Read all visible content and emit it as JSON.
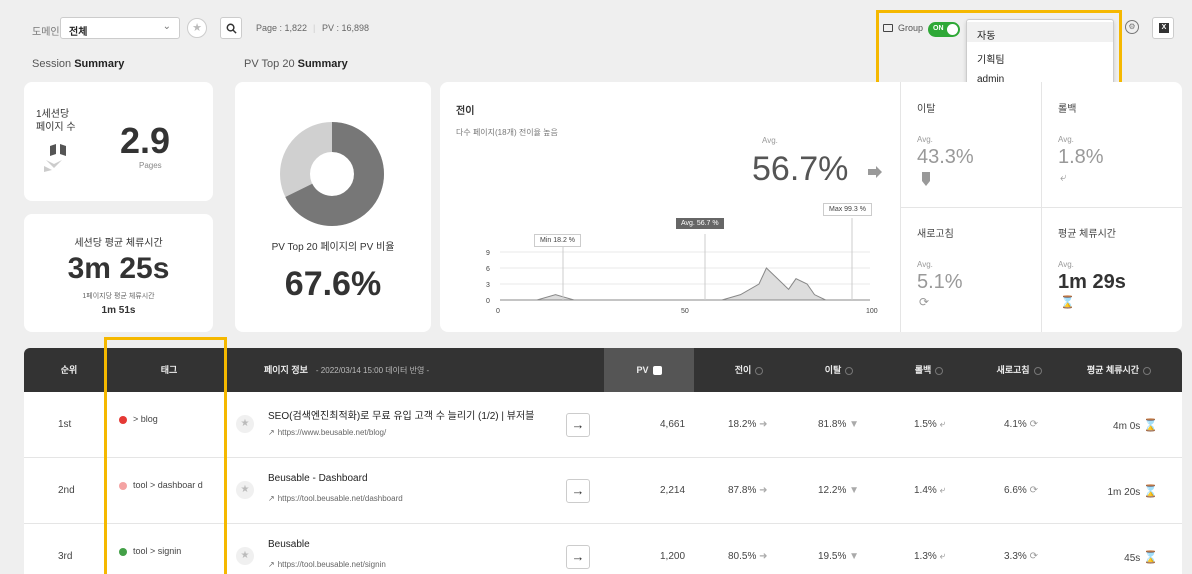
{
  "topbar": {
    "domain_label": "도메인",
    "domain_value": "전체",
    "page_count": "Page : 1,822",
    "pv_count": "PV : 16,898",
    "group_label": "Group",
    "toggle_label": "ON",
    "dropdown_options": [
      "자동",
      "기획팀",
      "admin"
    ],
    "excel_label": "X"
  },
  "sections": {
    "session_summary": "Session",
    "session_summary_bold": "Summary",
    "pv_summary": "PV Top 20",
    "pv_summary_bold": "Summary"
  },
  "session": {
    "pages_per_session_label_1": "1세션당",
    "pages_per_session_label_2": "페이지 수",
    "pages_per_session_value": "2.9",
    "pages_unit": "Pages",
    "avg_dwell_label": "세션당 평균 체류시간",
    "avg_dwell_value": "3m 25s",
    "page_dwell_label": "1페이지당 평균 체류시간",
    "page_dwell_value": "1m 51s"
  },
  "pv_top": {
    "ratio_label": "PV Top 20 페이지의 PV 비율",
    "ratio_value": "67.6%",
    "donut_fraction": 0.676
  },
  "transition": {
    "title": "전이",
    "subtitle": "다수 페이지(18개) 전이율 높음",
    "avg_label": "Avg.",
    "avg_value": "56.7%",
    "callouts": [
      "Min 18.2 %",
      "Avg. 56.7 %",
      "Max 99.3 %"
    ]
  },
  "chart_data": {
    "type": "area",
    "x_ticks": [
      "0",
      "50",
      "100"
    ],
    "y_ticks": [
      "9",
      "6",
      "3",
      "0"
    ],
    "xlim": [
      0,
      100
    ],
    "ylim": [
      0,
      9
    ],
    "x": [
      0,
      10,
      15,
      20,
      50,
      60,
      65,
      70,
      72,
      75,
      78,
      80,
      83,
      85,
      88,
      90,
      100
    ],
    "y": [
      0,
      0,
      1,
      0,
      0,
      0,
      1,
      3,
      6,
      4,
      2,
      4,
      3,
      1,
      0,
      0,
      0
    ]
  },
  "stats": [
    {
      "title": "이탈",
      "avg": "Avg.",
      "value": "43.3%",
      "icon": "exit-icon"
    },
    {
      "title": "롤백",
      "avg": "Avg.",
      "value": "1.8%",
      "icon": "rollback-icon"
    },
    {
      "title": "새로고침",
      "avg": "Avg.",
      "value": "5.1%",
      "icon": "refresh-icon"
    },
    {
      "title": "평균 체류시간",
      "avg": "Avg.",
      "value": "1m 29s",
      "icon": "hourglass-icon"
    }
  ],
  "table": {
    "headers": {
      "rank": "순위",
      "tag": "태그",
      "page_info": "페이지 정보",
      "page_info_note": "- 2022/03/14 15:00 데이터 반영 -",
      "pv": "PV",
      "transition": "전이",
      "exit": "이탈",
      "rollback": "롤백",
      "refresh": "새로고침",
      "dwell": "평균 체류시간"
    },
    "rows": [
      {
        "rank": "1st",
        "tag": "> blog",
        "tag_color": "#e53935",
        "title": "SEO(검색엔진최적화)로 무료 유입 고객 수 늘리기 (1/2) | 뷰저블",
        "url": "https://www.beusable.net/blog/",
        "pv": "4,661",
        "transition": "18.2%",
        "exit": "81.8%",
        "rollback": "1.5%",
        "refresh": "4.1%",
        "dwell": "4m 0s"
      },
      {
        "rank": "2nd",
        "tag": "tool > dashboar d",
        "tag_color": "#f4a3a3",
        "title": "Beusable - Dashboard",
        "url": "https://tool.beusable.net/dashboard",
        "pv": "2,214",
        "transition": "87.8%",
        "exit": "12.2%",
        "rollback": "1.4%",
        "refresh": "6.6%",
        "dwell": "1m 20s"
      },
      {
        "rank": "3rd",
        "tag": "tool > signin",
        "tag_color": "#43a047",
        "title": "Beusable",
        "url": "https://tool.beusable.net/signin",
        "pv": "1,200",
        "transition": "80.5%",
        "exit": "19.5%",
        "rollback": "1.3%",
        "refresh": "3.3%",
        "dwell": "45s"
      }
    ]
  }
}
